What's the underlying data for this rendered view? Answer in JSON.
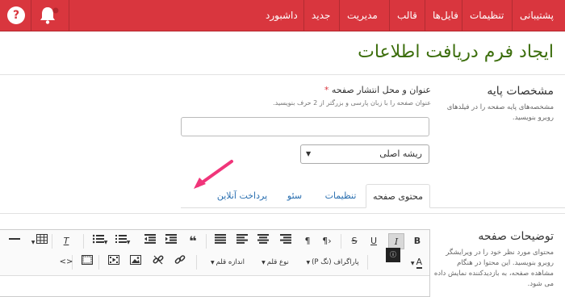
{
  "nav": {
    "items": [
      "داشبورد",
      "جدید",
      "مدیریت",
      "قالب",
      "فایل‌ها",
      "تنظیمات",
      "پشتیبانی"
    ],
    "help_label": "?"
  },
  "colors": {
    "brand": "#d9363e",
    "title": "#3c6e0c",
    "link": "#2a6fb0"
  },
  "page": {
    "title": "ایجاد فرم دریافت اطلاعات"
  },
  "basic": {
    "title": "مشخصات پایه",
    "desc": "مشخصه‌های پایه صفحه را در فیلدهای روبرو بنویسید."
  },
  "form": {
    "title_label": "عنوان و محل انتشار صفحه",
    "required_mark": "*",
    "title_help": "عنوان صفحه را با زبان پارسی و بزرگتر از 2 حرف بنویسید.",
    "title_value": "",
    "parent_select": "ریشه اصلی"
  },
  "tabs": [
    "محتوی صفحه",
    "تنظیمات",
    "سئو",
    "پرداخت آنلاین"
  ],
  "description": {
    "title": "توضیحات صفحه",
    "desc": "محتوای مورد نظر خود را در ویرایشگر روبرو بنویسید. این محتوا در هنگام مشاهده صفحه، به بازدیدکننده نمایش داده می شود."
  },
  "editor": {
    "buttons_row1": [
      "B",
      "I",
      "U",
      "S",
      "¶",
      "❝"
    ],
    "paragraph_menu": "پاراگراف (تگ P)",
    "font_menu": "نوع قلم",
    "size_menu": "اندازه قلم",
    "source_button": "<>",
    "text_color": "A"
  }
}
